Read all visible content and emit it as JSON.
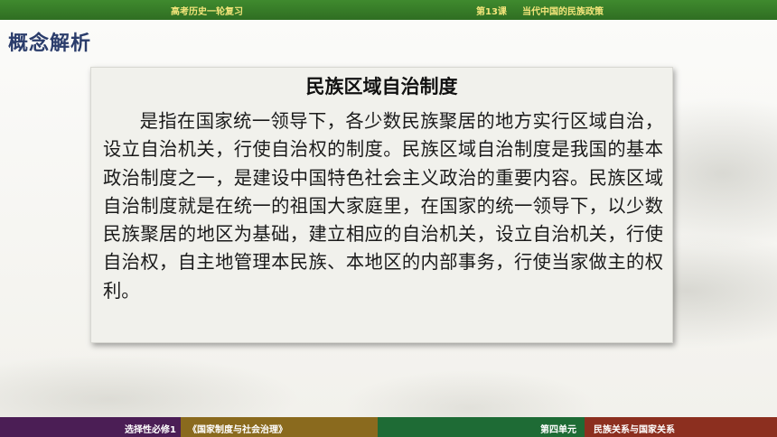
{
  "header": {
    "course": "高考历史一轮复习",
    "lesson_number": "第13课",
    "lesson_title": "当代中国的民族政策"
  },
  "section_heading": "概念解析",
  "card": {
    "title": "民族区域自治制度",
    "body": "是指在国家统一领导下，各少数民族聚居的地方实行区域自治，设立自治机关，行使自治权的制度。民族区域自治制度是我国的基本政治制度之一，是建设中国特色社会主义政治的重要内容。民族区域自治制度就是在统一的祖国大家庭里，在国家的统一领导下，以少数民族聚居的地区为基础，建立相应的自治机关，设立自治机关，行使自治权，自主地管理本民族、本地区的内部事务，行使当家做主的权利。"
  },
  "footer": {
    "module": "选择性必修1",
    "book": "《国家制度与社会治理》",
    "unit": "第四单元",
    "unit_title": "民族关系与国家关系"
  },
  "colors": {
    "header_bar": "#3f8a2e",
    "header_text": "#f3e57a",
    "heading_text": "#2a3c6b",
    "footer_purple": "#4b1e55",
    "footer_olive": "#8a6a1e",
    "footer_green": "#1e6b35",
    "footer_red": "#8c2f1f"
  }
}
